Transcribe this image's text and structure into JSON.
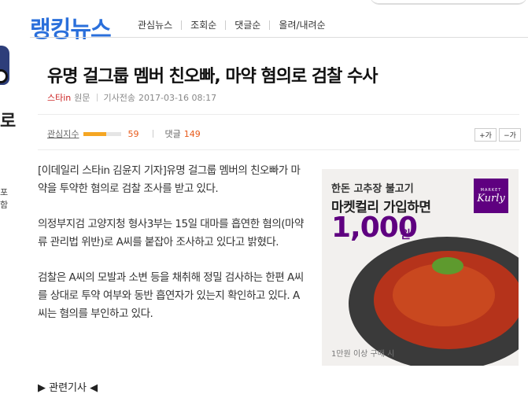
{
  "logo": "랭킹뉴스",
  "nav": [
    "관심뉴스",
    "조회순",
    "댓글순",
    "올려/내려순"
  ],
  "left_edge": {
    "text1": "로",
    "text2": "포함"
  },
  "article": {
    "headline": "유명 걸그룹 멤버 친오빠, 마약 혐의로 검찰 수사",
    "press": "스타in",
    "origin_label": "원문",
    "date_label": "기사전송",
    "date": "2017-03-16 08:17",
    "interest_label": "관심지수",
    "interest_value": "59",
    "interest_level_percent": 59,
    "comment_label": "댓글",
    "comment_count": "149",
    "font_larger": "+가",
    "font_smaller": "−가",
    "paragraphs": [
      "[이데일리 스타in 김윤지 기자]유명 걸그룹 멤버의 친오빠가 마약을 투약한 혐의로 검찰 조사를 받고 있다.",
      "의정부지검 고양지청 형사3부는 15일 대마를 흡연한 혐의(마약류 관리법 위반)로 A씨를 붙잡아 조사하고 있다고 밝혔다.",
      "검찰은 A씨의 모발과 소변 등을 채취해 정밀 검사하는 한편 A씨를 상대로 투약 여부와 동반 흡연자가 있는지 확인하고 있다. A씨는 혐의를 부인하고 있다."
    ],
    "related": "▶ 관련기사 ◀"
  },
  "ad": {
    "line1": "한돈 고추장 불고기",
    "line2": "마켓컬리 가입하면",
    "price": "1,000",
    "unit": "원",
    "footnote": "1만원 이상 구매 시",
    "badge_top": "MARKET",
    "badge_brand": "Kurly"
  }
}
